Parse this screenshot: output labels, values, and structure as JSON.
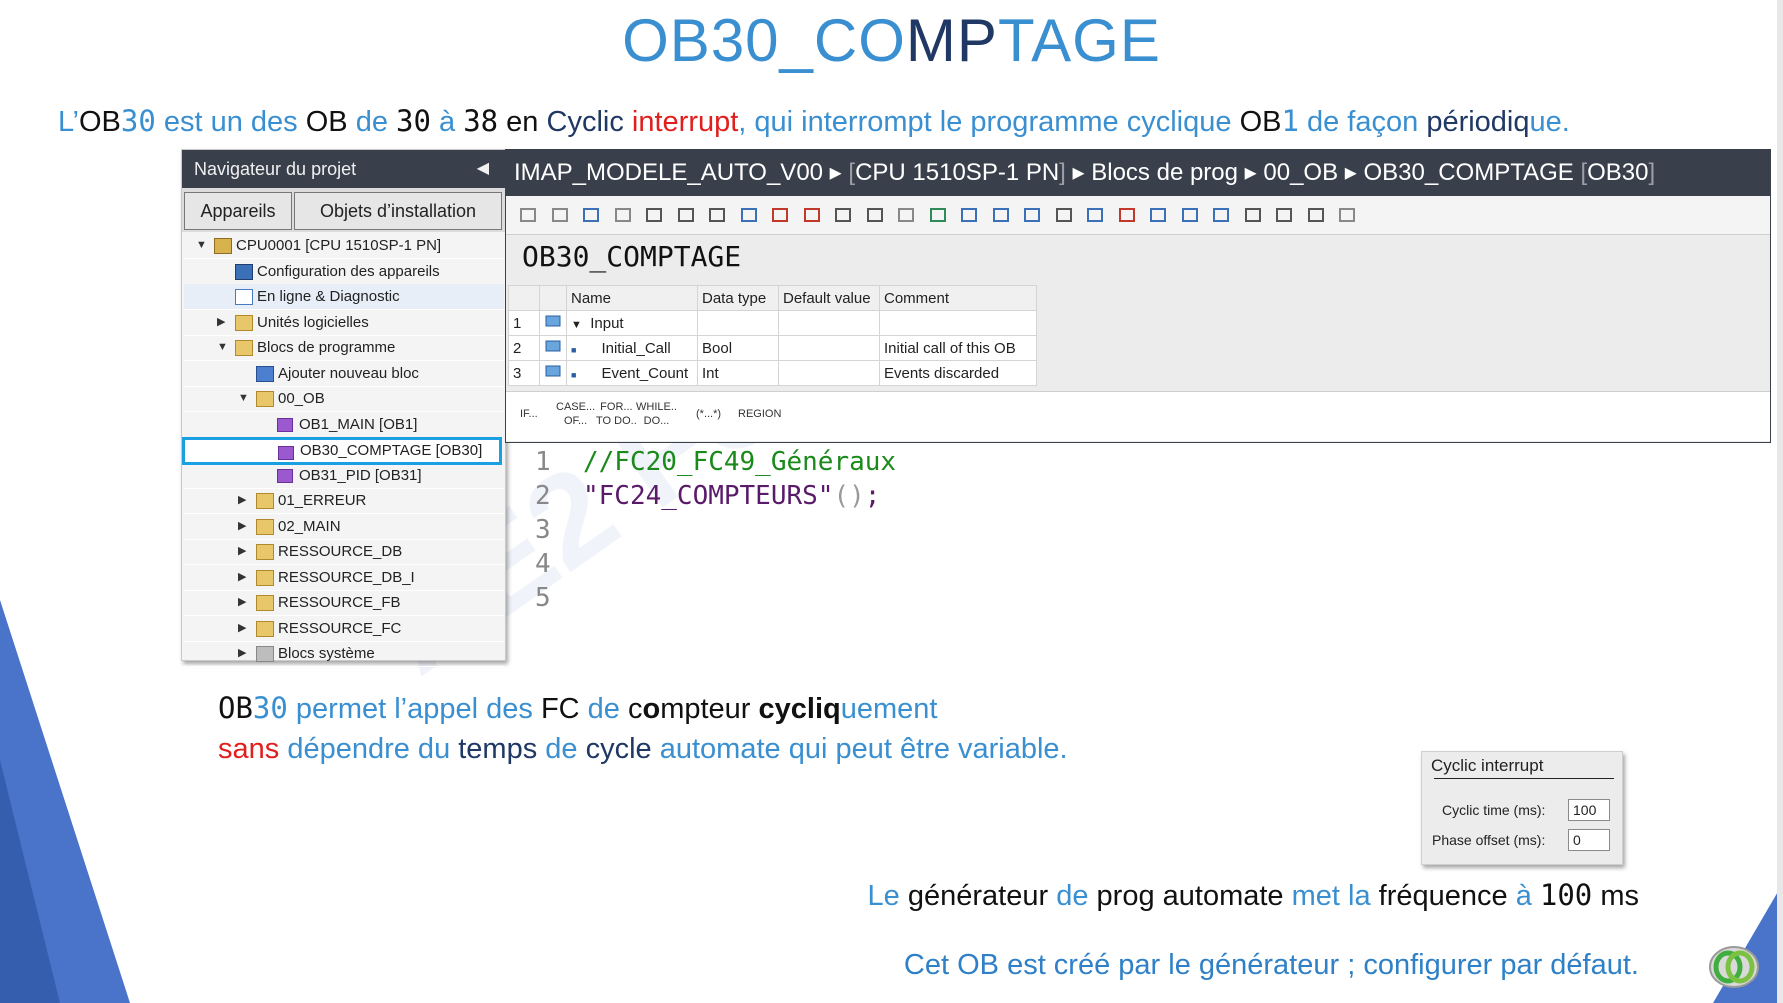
{
  "title": {
    "part1": "OB30_CO",
    "part2": "M",
    "part3": "P",
    "part4": "T",
    "part5": "AGE"
  },
  "intro": {
    "p1": "L’",
    "p2": "OB",
    "p3": "30",
    "p4": " est un des ",
    "p5": "OB",
    "p6": " de ",
    "p7": "30",
    "p8": " à ",
    "p9": "38",
    "p10": " en ",
    "p11": "Cyclic",
    "p12": " interrupt",
    "p13": ", qui interrompt le programme cyclique ",
    "p14": "OB",
    "p15": "1",
    "p16": " de façon ",
    "p17": "périodiq",
    "p18": "ue."
  },
  "navigator": {
    "title": "Navigateur du projet",
    "tabs": [
      "Appareils",
      "Objets d’installation"
    ],
    "items": [
      {
        "label": "CPU0001 [CPU 1510SP-1 PN]",
        "level": 0,
        "twisty": "▼",
        "icon": "cpu"
      },
      {
        "label": "Configuration des appareils",
        "level": 1,
        "twisty": "",
        "icon": "cfg"
      },
      {
        "label": "En ligne & Diagnostic",
        "level": 1,
        "twisty": "",
        "icon": "diag"
      },
      {
        "label": "Unités logicielles",
        "level": 1,
        "twisty": "▶",
        "icon": "folder"
      },
      {
        "label": "Blocs de programme",
        "level": 1,
        "twisty": "▼",
        "icon": "folder"
      },
      {
        "label": "Ajouter nouveau bloc",
        "level": 2,
        "twisty": "",
        "icon": "add"
      },
      {
        "label": "00_OB",
        "level": 2,
        "twisty": "▼",
        "icon": "folder"
      },
      {
        "label": "OB1_MAIN [OB1]",
        "level": 3,
        "twisty": "",
        "icon": "block"
      },
      {
        "label": "OB30_COMPTAGE [OB30]",
        "level": 3,
        "twisty": "",
        "icon": "block"
      },
      {
        "label": "OB31_PID [OB31]",
        "level": 3,
        "twisty": "",
        "icon": "block"
      },
      {
        "label": "01_ERREUR",
        "level": 2,
        "twisty": "▶",
        "icon": "folder"
      },
      {
        "label": "02_MAIN",
        "level": 2,
        "twisty": "▶",
        "icon": "folder"
      },
      {
        "label": "RESSOURCE_DB",
        "level": 2,
        "twisty": "▶",
        "icon": "folder"
      },
      {
        "label": "RESSOURCE_DB_I",
        "level": 2,
        "twisty": "▶",
        "icon": "folder"
      },
      {
        "label": "RESSOURCE_FB",
        "level": 2,
        "twisty": "▶",
        "icon": "folder"
      },
      {
        "label": "RESSOURCE_FC",
        "level": 2,
        "twisty": "▶",
        "icon": "folder"
      },
      {
        "label": "Blocs système",
        "level": 2,
        "twisty": "▶",
        "icon": "sys"
      }
    ]
  },
  "editor": {
    "breadcrumb": {
      "c1": "IMAP_MODELE_AUTO_V00",
      "c2": "[",
      "c3": "CPU 1510SP-1 PN",
      "c4": "]",
      "c5": "Blocs de prog",
      "c6": "00_OB",
      "c7": "OB30_COMPTAGE",
      "c8": "[",
      "c9": "OB30",
      "c10": "]"
    },
    "block_title": "OB30_COMPTAGE",
    "table": {
      "headers": [
        "Name",
        "Data type",
        "Default value",
        "Comment"
      ],
      "rows": [
        {
          "n": "1",
          "name": "Input",
          "type": "",
          "def": "",
          "comment": ""
        },
        {
          "n": "2",
          "name": "Initial_Call",
          "type": "Bool",
          "def": "",
          "comment": "Initial call of this OB"
        },
        {
          "n": "3",
          "name": "Event_Count",
          "type": "Int",
          "def": "",
          "comment": "Events discarded"
        }
      ]
    },
    "instr": [
      {
        "a": "IF...",
        "b": ""
      },
      {
        "a": "CASE...",
        "b": "OF..."
      },
      {
        "a": "FOR...",
        "b": "TO DO.."
      },
      {
        "a": "WHILE..",
        "b": "DO..."
      },
      {
        "a": "(*...*)",
        "b": ""
      },
      {
        "a": "REGION",
        "b": ""
      }
    ]
  },
  "code": {
    "lines": [
      "1",
      "2",
      "3",
      "4",
      "5"
    ],
    "l1": "//FC20_FC49_Généraux",
    "l2a": "\"FC24_COMPTEURS\"",
    "l2b": "()",
    "l2c": ";"
  },
  "desc": {
    "a1": "OB",
    "a2": "30",
    "a3": " permet l’appel des ",
    "a4": "FC",
    "a5": " de ",
    "a6": "c",
    "a7": "o",
    "a8": "mpt",
    "a9": "eur ",
    "a10": "cycliq",
    "a11": "uement",
    "b1": "sans",
    "b2": " dépendre du ",
    "b3": "temps",
    "b4": " de ",
    "b5": "cycle",
    "b6": " automate qui peut être variable."
  },
  "cyclic": {
    "title": "Cyclic interrupt",
    "time_label": "Cyclic time (ms):",
    "time_value": "100",
    "phase_label": "Phase offset (ms):",
    "phase_value": "0"
  },
  "gen": {
    "g1": "Le ",
    "g2": "générateur",
    "g3": " de ",
    "g4": "prog automate",
    "g5": " met la ",
    "g6": "fréquence",
    "g7": " à ",
    "g8": "100",
    "g9": " ms"
  },
  "footer": "Cet OB est créé par le générateur ; configurer par défaut.",
  "watermark": "AE2 FORMA"
}
